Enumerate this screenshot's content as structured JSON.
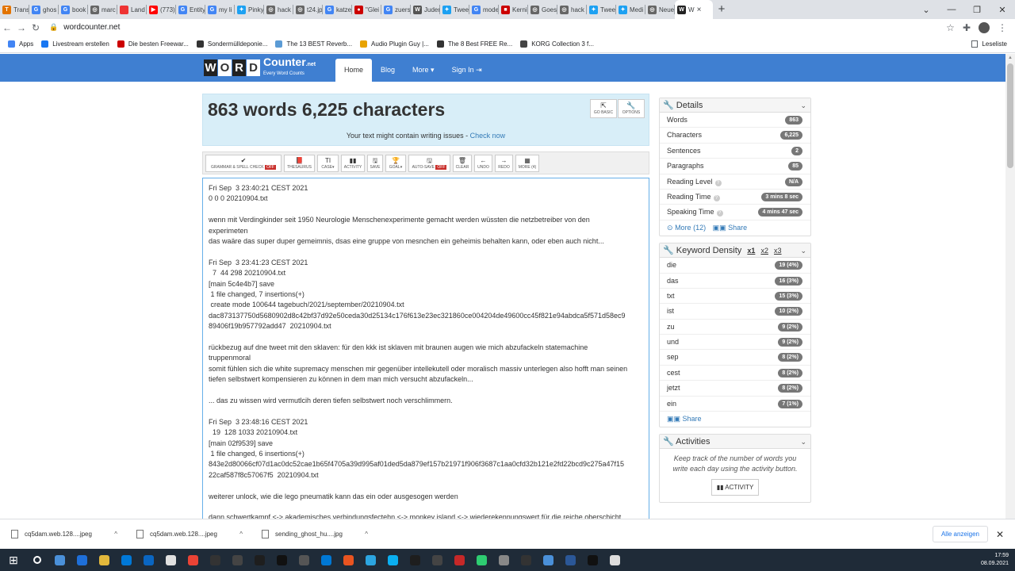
{
  "browser": {
    "tabs": [
      {
        "label": "Trans",
        "fav": "#e37400",
        "glyph": "T"
      },
      {
        "label": "ghos",
        "fav": "#4285f4",
        "glyph": "G"
      },
      {
        "label": "book",
        "fav": "#4285f4",
        "glyph": "G"
      },
      {
        "label": "marc",
        "fav": "#666",
        "glyph": "◎"
      },
      {
        "label": "Land",
        "fav": "#e33",
        "glyph": ""
      },
      {
        "label": "(773)",
        "fav": "#f00",
        "glyph": "▶"
      },
      {
        "label": "Entity",
        "fav": "#4285f4",
        "glyph": "G"
      },
      {
        "label": "my li",
        "fav": "#4285f4",
        "glyph": "G"
      },
      {
        "label": "Pinky",
        "fav": "#1da1f2",
        "glyph": "✦"
      },
      {
        "label": "hack",
        "fav": "#666",
        "glyph": "◎"
      },
      {
        "label": "t24.jp",
        "fav": "#666",
        "glyph": "◎"
      },
      {
        "label": "katze",
        "fav": "#4285f4",
        "glyph": "G"
      },
      {
        "label": "\"Glei",
        "fav": "#c00",
        "glyph": "●"
      },
      {
        "label": "zuers",
        "fav": "#4285f4",
        "glyph": "G"
      },
      {
        "label": "Juder",
        "fav": "#555",
        "glyph": "W"
      },
      {
        "label": "Twee",
        "fav": "#1da1f2",
        "glyph": "✦"
      },
      {
        "label": "mode",
        "fav": "#4285f4",
        "glyph": "G"
      },
      {
        "label": "Kerni",
        "fav": "#c00",
        "glyph": "■"
      },
      {
        "label": "Goes",
        "fav": "#666",
        "glyph": "◎"
      },
      {
        "label": "hack",
        "fav": "#666",
        "glyph": "◎"
      },
      {
        "label": "Twee",
        "fav": "#1da1f2",
        "glyph": "✦"
      },
      {
        "label": "Medi",
        "fav": "#1da1f2",
        "glyph": "✦"
      },
      {
        "label": "Neue",
        "fav": "#666",
        "glyph": "◎"
      }
    ],
    "active_tab": {
      "label": "W",
      "glyph": "W"
    },
    "url": "wordcounter.net",
    "bookmarks": [
      {
        "label": "Apps",
        "color": "#4285f4"
      },
      {
        "label": "Livestream erstellen",
        "color": "#1877f2"
      },
      {
        "label": "Die besten Freewar...",
        "color": "#c00"
      },
      {
        "label": "Sondermülldeponie...",
        "color": "#333"
      },
      {
        "label": "The 13 BEST Reverb...",
        "color": "#5b9bd5"
      },
      {
        "label": "Audio Plugin Guy |...",
        "color": "#e8a300"
      },
      {
        "label": "The 8 Best FREE Re...",
        "color": "#333"
      },
      {
        "label": "KORG Collection 3 f...",
        "color": "#444"
      }
    ],
    "reading_list": "Leseliste"
  },
  "site": {
    "logo_letters": [
      "W",
      "O",
      "R",
      "D"
    ],
    "logo_name": "Counter",
    "logo_suffix": ".net",
    "logo_tagline": "Every Word Counts",
    "nav": {
      "home": "Home",
      "blog": "Blog",
      "more": "More ▾",
      "signin": "Sign In ⇥"
    }
  },
  "header": {
    "title": "863 words 6,225 characters",
    "go_basic": "GO BASIC",
    "options": "OPTIONS",
    "issue_text": "Your text might contain writing issues - ",
    "issue_link": "Check now"
  },
  "toolbar": {
    "grammar": "GRAMMAR & SPELL CHECK",
    "off": "OFF",
    "thesaurus": "THESAURUS",
    "case": "CASE",
    "activity": "ACTIVITY",
    "save": "SAVE",
    "goal": "GOAL",
    "autosave": "AUTO-SAVE",
    "clear": "CLEAR",
    "undo": "UNDO",
    "redo": "REDO",
    "more": "MORE (4)"
  },
  "editor_lines": [
    "Fri Sep  3 23:40:21 CEST 2021",
    "0 0 0 20210904.txt",
    "",
    "wenn mit Verdingkinder seit 1950 Neurologie Menschenexperimente gemacht werden wüssten die netzbetreiber von den",
    "experimeten",
    "das waäre das super duper gemeimnis, dsas eine gruppe von mesnchen ein geheimis behalten kann, oder eben auch nicht...",
    "",
    "Fri Sep  3 23:41:23 CEST 2021",
    "  7  44 298 20210904.txt",
    "[main 5c4e4b7] save",
    " 1 file changed, 7 insertions(+)",
    " create mode 100644 tagebuch/2021/september/20210904.txt",
    "dac873137750d5680902d8c42bf37d92e50ceda30d25134c176f613e23ec321860ce004204de49600cc45f821e94abdca5f571d58ec9",
    "89406f19b957792add47  20210904.txt",
    "",
    "rückbezug auf dne tweet mit den sklaven: für den kkk ist sklaven mit braunen augen wie mich abzufackeln statemachine",
    "truppenmoral",
    "somit fühlen sich die white supremacy menschen mir gegenüber intellekutell oder moralisch massiv unterlegen also hofft man seinen",
    "tiefen selbstwert kompensieren zu können in dem man mich versucht abzufackeln...",
    "",
    "... das zu wissen wird vermutlcih deren tiefen selbstwert noch verschlimmern.",
    "",
    "Fri Sep  3 23:48:16 CEST 2021",
    "  19  128 1033 20210904.txt",
    "[main 02f9539] save",
    " 1 file changed, 6 insertions(+)",
    "843e2d80066cf07d1ac0dc52cae1b65f4705a39d995af01ded5da879ef157b21971f906f3687c1aa0cfd32b121e2fd22bcd9c275a47f15",
    "22caf587f8c57067f5  20210904.txt",
    "",
    "weiterer unlock, wie die lego pneumatik kann das ein oder ausgesogen werden",
    "",
    "dann schwertkampf <-> akademisches verbindungsfectehn <-> monkey island <-> wiederekennungswert für die reiche oberschicht"
  ],
  "details": {
    "title": "Details",
    "rows": [
      {
        "label": "Words",
        "value": "863",
        "help": false
      },
      {
        "label": "Characters",
        "value": "6,225",
        "help": false
      },
      {
        "label": "Sentences",
        "value": "2",
        "help": false
      },
      {
        "label": "Paragraphs",
        "value": "85",
        "help": false
      },
      {
        "label": "Reading Level",
        "value": "N/A",
        "help": true
      },
      {
        "label": "Reading Time",
        "value": "3 mins 8 sec",
        "help": true
      },
      {
        "label": "Speaking Time",
        "value": "4 mins 47 sec",
        "help": true
      }
    ],
    "more": "More (12)",
    "share": "Share"
  },
  "keyword_density": {
    "title": "Keyword Density",
    "x1": "x1",
    "x2": "x2",
    "x3": "x3",
    "rows": [
      {
        "word": "die",
        "value": "19 (4%)"
      },
      {
        "word": "das",
        "value": "16 (3%)"
      },
      {
        "word": "txt",
        "value": "15 (3%)"
      },
      {
        "word": "ist",
        "value": "10 (2%)"
      },
      {
        "word": "zu",
        "value": "9 (2%)"
      },
      {
        "word": "und",
        "value": "9 (2%)"
      },
      {
        "word": "sep",
        "value": "8 (2%)"
      },
      {
        "word": "cest",
        "value": "8 (2%)"
      },
      {
        "word": "jetzt",
        "value": "8 (2%)"
      },
      {
        "word": "ein",
        "value": "7 (1%)"
      }
    ],
    "share": "Share"
  },
  "activities": {
    "title": "Activities",
    "text": "Keep track of the number of words you write each day using the activity button.",
    "button": "ACTIVITY"
  },
  "downloads": {
    "items": [
      "cq5dam.web.128....jpeg",
      "cq5dam.web.128....jpeg",
      "sending_ghost_hu....jpg"
    ],
    "show_all": "Alle anzeigen"
  },
  "taskbar": {
    "time": "17:59",
    "date": "08.09.2021",
    "icons": [
      "#4a90d9",
      "#1e6fd9",
      "#e2b83c",
      "#0078d7",
      "#0a66c2",
      "#e0e0e0",
      "#ea4335",
      "#333",
      "#444",
      "#1e1e1e",
      "#111",
      "#555",
      "#0078d4",
      "#e95420",
      "#2ca5e0",
      "#0aaff1",
      "#1e1e1e",
      "#444",
      "#c62828",
      "#2ecc71",
      "#888",
      "#333",
      "#4a90d9",
      "#2b5797",
      "#111",
      "#ddd"
    ]
  }
}
